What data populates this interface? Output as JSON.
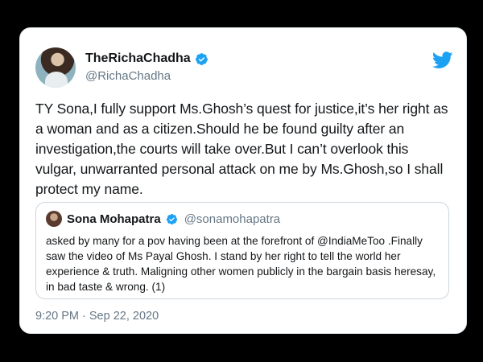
{
  "tweet": {
    "display_name": "TheRichaChadha",
    "handle": "@RichaChadha",
    "text": "TY Sona,I fully support Ms.Ghosh’s quest for justice,it’s her right as a woman and as a citizen.Should he be found guilty after an investigation,the courts will take over.But I can’t overlook this vulgar, unwarranted personal attack on me by Ms.Ghosh,so I shall protect my name.",
    "timestamp": "9:20 PM · Sep 22, 2020"
  },
  "quoted_tweet": {
    "display_name": "Sona Mohapatra",
    "handle": "@sonamohapatra",
    "text": "asked by many for a pov having been at the forefront of @IndiaMeToo .Finally saw the video of Ms Payal Ghosh. I stand by her right to tell the world her experience & truth. Maligning other women publicly in the bargain basis heresay, in bad taste & wrong. (1)"
  },
  "colors": {
    "twitter_blue": "#1da1f2",
    "text_primary": "#14171a",
    "text_secondary": "#657786",
    "background": "#000000"
  },
  "icons": {
    "brand": "twitter-bird-icon",
    "verified": "verified-badge-icon"
  }
}
